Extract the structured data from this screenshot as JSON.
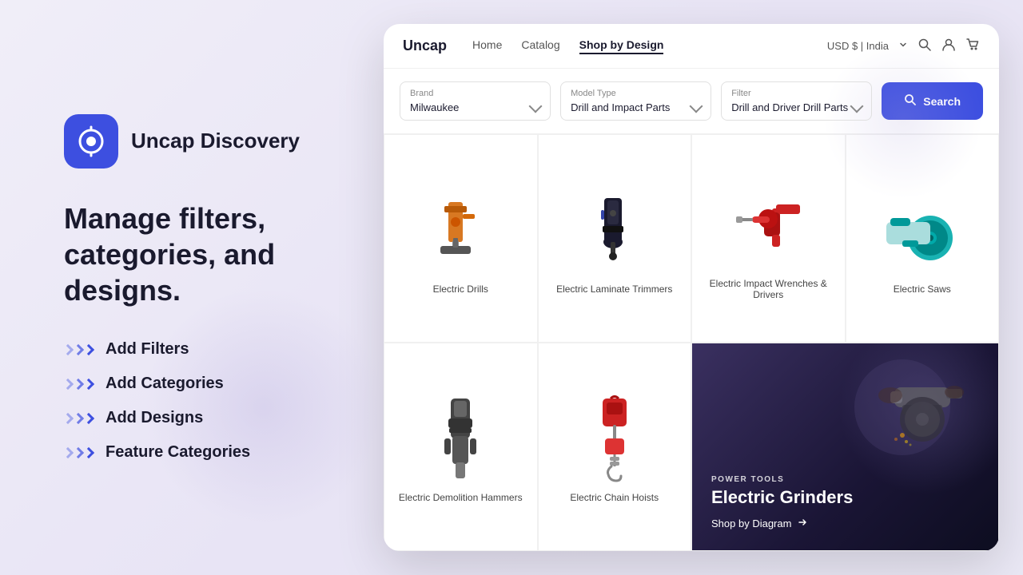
{
  "logo": {
    "icon_symbol": "◎",
    "app_name": "Uncap Discovery"
  },
  "headline": "Manage filters, categories, and designs.",
  "features": [
    {
      "id": "add-filters",
      "label": "Add Filters"
    },
    {
      "id": "add-categories",
      "label": "Add Categories"
    },
    {
      "id": "add-designs",
      "label": "Add Designs"
    },
    {
      "id": "feature-categories",
      "label": "Feature Categories"
    }
  ],
  "nav": {
    "logo": "Uncap",
    "links": [
      {
        "id": "home",
        "label": "Home",
        "active": false
      },
      {
        "id": "catalog",
        "label": "Catalog",
        "active": false
      },
      {
        "id": "shop-by-design",
        "label": "Shop by Design",
        "active": true
      }
    ],
    "currency": "USD $ | India",
    "icons": [
      "search",
      "user",
      "cart"
    ]
  },
  "filters": {
    "brand": {
      "label": "Brand",
      "value": "Milwaukee"
    },
    "model_type": {
      "label": "Model Type",
      "value": "Drill and Impact Parts"
    },
    "filter": {
      "label": "Filter",
      "value": "Drill and Driver Drill Parts"
    },
    "search_button": "Search"
  },
  "products": [
    {
      "id": "electric-drills",
      "name": "Electric Drills",
      "color": "#e07820",
      "type": "drill"
    },
    {
      "id": "electric-laminate-trimmers",
      "name": "Electric Laminate Trimmers",
      "color": "#1a1a2e",
      "type": "trimmer"
    },
    {
      "id": "electric-impact-wrenches",
      "name": "Electric Impact Wrenches & Drivers",
      "color": "#cc2222",
      "type": "wrench"
    },
    {
      "id": "electric-saws",
      "name": "Electric Saws",
      "color": "#00aaaa",
      "type": "saw"
    },
    {
      "id": "electric-demolition-hammers",
      "name": "Electric Demolition Hammers",
      "color": "#444",
      "type": "hammer"
    },
    {
      "id": "electric-chain-hoists",
      "name": "Electric Chain Hoists",
      "color": "#cc2222",
      "type": "hoist"
    }
  ],
  "featured": {
    "category": "POWER TOOLS",
    "title": "Electric Grinders",
    "link_label": "Shop by Diagram"
  }
}
